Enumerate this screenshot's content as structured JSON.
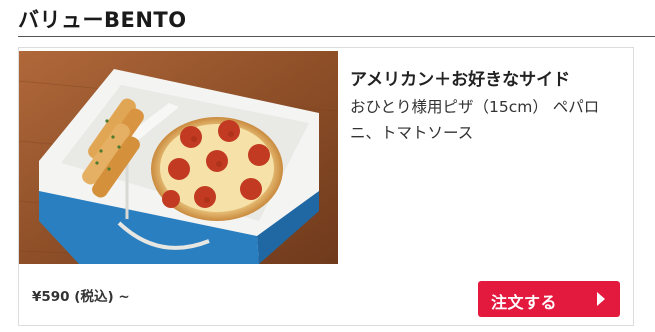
{
  "section": {
    "title": "バリューBENTO"
  },
  "product": {
    "name": "アメリカン＋お好きなサイド",
    "description": "おひとり様用ピザ（15cm） ペパロニ、トマトソース",
    "image_alt": "pizza-bento-box",
    "price": "¥590 (税込) ~"
  },
  "actions": {
    "order_label": "注文する",
    "order_icon": "chevron-right-icon"
  },
  "colors": {
    "accent": "#e3193d",
    "box_blue": "#2a7fc1"
  }
}
